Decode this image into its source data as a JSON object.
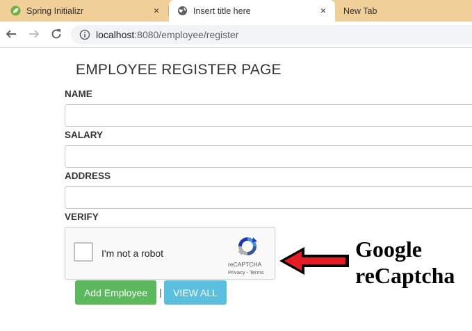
{
  "browser": {
    "tabs": [
      {
        "title": "Spring Initializr",
        "icon": "spring-leaf-icon",
        "active": false
      },
      {
        "title": "Insert title here",
        "icon": "globe-icon",
        "active": true
      },
      {
        "title": "New Tab",
        "active": false
      }
    ],
    "close_glyph": "×",
    "url_host": "localhost",
    "url_path": ":8080/employee/register"
  },
  "page": {
    "title": "EMPLOYEE REGISTER PAGE",
    "fields": {
      "name_label": "NAME",
      "name_value": "",
      "salary_label": "SALARY",
      "salary_value": "",
      "address_label": "ADDRESS",
      "address_value": "",
      "verify_label": "VERIFY"
    },
    "captcha": {
      "checkbox_label": "I'm not a robot",
      "brand": "reCAPTCHA",
      "links": "Privacy - Terms",
      "checked": false
    },
    "buttons": {
      "add_label": "Add Employee",
      "separator": "|",
      "view_label": "VIEW ALL"
    }
  },
  "annotation": {
    "line1": "Google",
    "line2": "reCaptcha",
    "arrow_color": "#e51c23"
  },
  "colors": {
    "tabbar": "#f0cf98",
    "add_button": "#5cb85c",
    "view_button": "#5bc0de"
  }
}
